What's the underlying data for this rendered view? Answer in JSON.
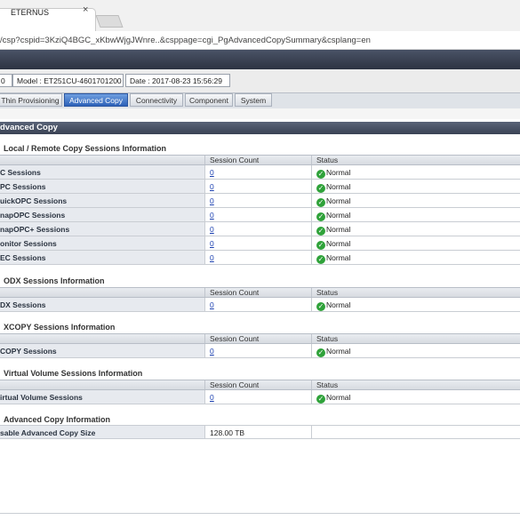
{
  "browser": {
    "tab_title": "ETERNUS",
    "tab_close": "×",
    "url": "/csp?cspid=3KziQ4BGC_xKbwWjgJWnre..&csppage=cgi_PgAdvancedCopySummary&csplang=en"
  },
  "infobar": {
    "item0": "0",
    "model": "Model : ET251CU-4601701200",
    "date": "Date : 2017-08-23 15:56:29"
  },
  "nav": {
    "tabs": [
      "Thin Provisioning",
      "Advanced Copy",
      "Connectivity",
      "Component",
      "System"
    ],
    "active": "Advanced Copy"
  },
  "section_title": "dvanced Copy",
  "columns": {
    "count": "Session Count",
    "status": "Status",
    "usable": ""
  },
  "groups": {
    "local_remote": {
      "title": "Local / Remote Copy Sessions Information",
      "rows": [
        {
          "label": "C Sessions",
          "count": "0",
          "status": "Normal"
        },
        {
          "label": "PC Sessions",
          "count": "0",
          "status": "Normal"
        },
        {
          "label": "uickOPC Sessions",
          "count": "0",
          "status": "Normal"
        },
        {
          "label": "napOPC Sessions",
          "count": "0",
          "status": "Normal"
        },
        {
          "label": "napOPC+ Sessions",
          "count": "0",
          "status": "Normal"
        },
        {
          "label": "onitor Sessions",
          "count": "0",
          "status": "Normal"
        },
        {
          "label": "EC Sessions",
          "count": "0",
          "status": "Normal"
        }
      ]
    },
    "odx": {
      "title": "ODX Sessions Information",
      "rows": [
        {
          "label": "DX Sessions",
          "count": "0",
          "status": "Normal"
        }
      ]
    },
    "xcopy": {
      "title": "XCOPY Sessions Information",
      "rows": [
        {
          "label": "COPY Sessions",
          "count": "0",
          "status": "Normal"
        }
      ]
    },
    "vvol": {
      "title": "Virtual Volume Sessions Information",
      "rows": [
        {
          "label": "irtual Volume Sessions",
          "count": "0",
          "status": "Normal"
        }
      ]
    },
    "advanced_copy_info": {
      "title": "Advanced Copy Information",
      "rows": [
        {
          "label": "sable Advanced Copy Size",
          "value": "128.00 TB"
        }
      ]
    }
  },
  "icons": {
    "status_ok": "check-circle-icon",
    "ok_color": "#2fa23a"
  },
  "colors": {
    "header_dark": "#2d3342",
    "active_tab": "#2e62b8",
    "link": "#1a3fb0"
  }
}
